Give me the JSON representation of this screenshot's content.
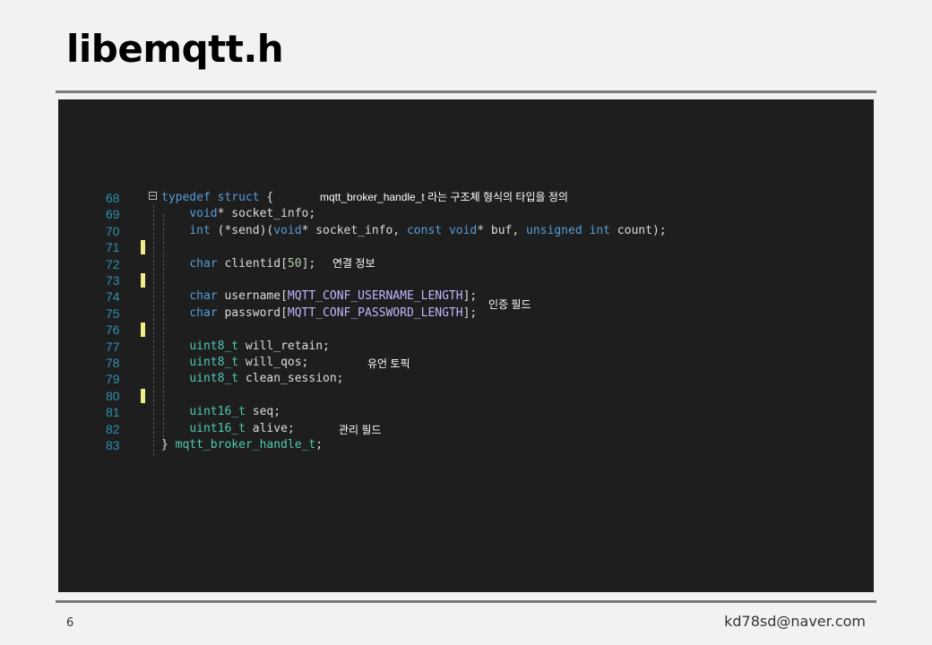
{
  "slide": {
    "title": "libemqtt.h",
    "page_number": "6",
    "email": "kd78sd@naver.com"
  },
  "code": {
    "lines": [
      {
        "n": "68",
        "parts": [
          [
            "kw",
            "typedef"
          ],
          [
            "pl",
            " "
          ],
          [
            "kw",
            "struct"
          ],
          [
            "pl",
            " {"
          ]
        ]
      },
      {
        "n": "69",
        "parts": [
          [
            "pl",
            "    "
          ],
          [
            "kw",
            "void"
          ],
          [
            "pl",
            "* socket_info;"
          ]
        ]
      },
      {
        "n": "70",
        "parts": [
          [
            "pl",
            "    "
          ],
          [
            "kw",
            "int"
          ],
          [
            "pl",
            " (*send)("
          ],
          [
            "kw",
            "void"
          ],
          [
            "pl",
            "* socket_info, "
          ],
          [
            "kw",
            "const"
          ],
          [
            "pl",
            " "
          ],
          [
            "kw",
            "void"
          ],
          [
            "pl",
            "* buf, "
          ],
          [
            "kw",
            "unsigned"
          ],
          [
            "pl",
            " "
          ],
          [
            "kw",
            "int"
          ],
          [
            "pl",
            " count);"
          ]
        ]
      },
      {
        "n": "71",
        "parts": [],
        "mark": true
      },
      {
        "n": "72",
        "parts": [
          [
            "pl",
            "    "
          ],
          [
            "kw",
            "char"
          ],
          [
            "pl",
            " clientid["
          ],
          [
            "num",
            "50"
          ],
          [
            "pl",
            "];"
          ]
        ]
      },
      {
        "n": "73",
        "parts": [],
        "mark": true
      },
      {
        "n": "74",
        "parts": [
          [
            "pl",
            "    "
          ],
          [
            "kw",
            "char"
          ],
          [
            "pl",
            " username["
          ],
          [
            "mac",
            "MQTT_CONF_USERNAME_LENGTH"
          ],
          [
            "pl",
            "];"
          ]
        ]
      },
      {
        "n": "75",
        "parts": [
          [
            "pl",
            "    "
          ],
          [
            "kw",
            "char"
          ],
          [
            "pl",
            " password["
          ],
          [
            "mac",
            "MQTT_CONF_PASSWORD_LENGTH"
          ],
          [
            "pl",
            "];"
          ]
        ]
      },
      {
        "n": "76",
        "parts": [],
        "mark": true
      },
      {
        "n": "77",
        "parts": [
          [
            "pl",
            "    "
          ],
          [
            "ty",
            "uint8_t"
          ],
          [
            "pl",
            " will_retain;"
          ]
        ]
      },
      {
        "n": "78",
        "parts": [
          [
            "pl",
            "    "
          ],
          [
            "ty",
            "uint8_t"
          ],
          [
            "pl",
            " will_qos;"
          ]
        ]
      },
      {
        "n": "79",
        "parts": [
          [
            "pl",
            "    "
          ],
          [
            "ty",
            "uint8_t"
          ],
          [
            "pl",
            " clean_session;"
          ]
        ]
      },
      {
        "n": "80",
        "parts": [],
        "mark": true
      },
      {
        "n": "81",
        "parts": [
          [
            "pl",
            "    "
          ],
          [
            "ty",
            "uint16_t"
          ],
          [
            "pl",
            " seq;"
          ]
        ]
      },
      {
        "n": "82",
        "parts": [
          [
            "pl",
            "    "
          ],
          [
            "ty",
            "uint16_t"
          ],
          [
            "pl",
            " alive;"
          ]
        ]
      },
      {
        "n": "83",
        "parts": [
          [
            "pl",
            "} "
          ],
          [
            "ty",
            "mqtt_broker_handle_t"
          ],
          [
            "pl",
            ";"
          ]
        ]
      }
    ]
  },
  "annotations": {
    "struct_note": "mqtt_broker_handle_t 라는 구조체 형식의 타입을 정의",
    "connection_note": "연결 정보",
    "auth_note": "인증 필드",
    "will_note": "유언 토픽",
    "manage_note": "관리 필드"
  }
}
